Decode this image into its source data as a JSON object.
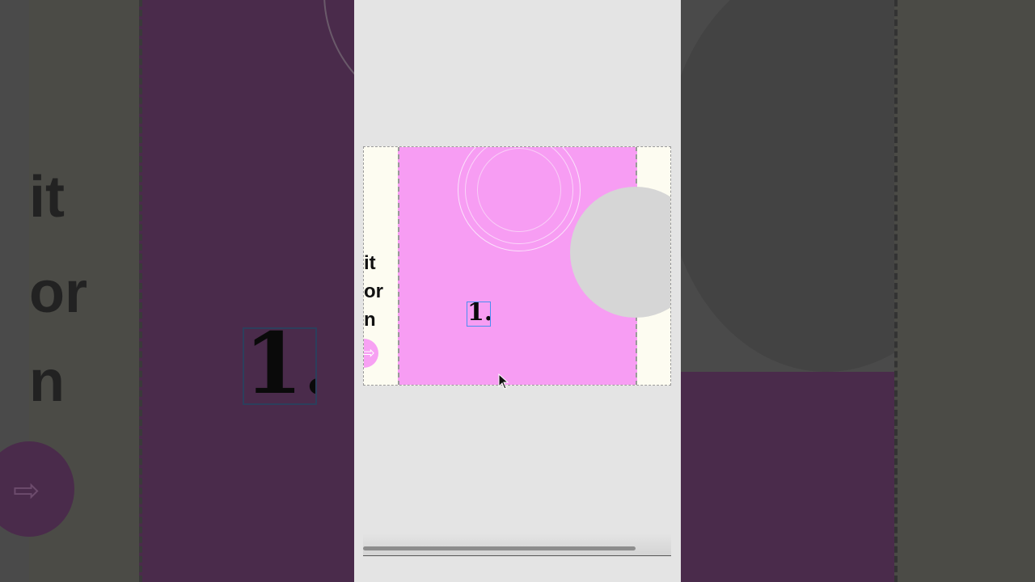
{
  "slide": {
    "text_lines": [
      "it",
      "or",
      "n"
    ],
    "number_label": "1."
  },
  "background": {
    "text_lines": [
      "it",
      "or",
      "n"
    ],
    "number_label": "1."
  },
  "icons": {
    "prev_arrow": "arrow-right-icon",
    "cursor": "pointer-cursor-icon"
  },
  "colors": {
    "pink_page": "#f79df3",
    "cream_page": "#fdfcf1",
    "grey_circle": "#d6d6d6",
    "selection": "#4a8ef0"
  }
}
